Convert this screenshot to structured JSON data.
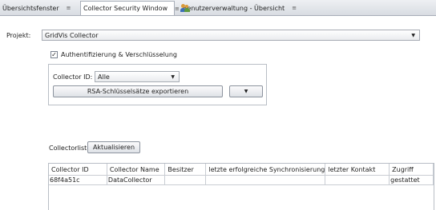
{
  "tabs": [
    {
      "label": "Übersichtsfenster",
      "close": "≡"
    },
    {
      "label": "Collector Security Window",
      "close": "≡"
    },
    {
      "label": "Benutzerverwaltung - Übersicht",
      "close": "≡"
    }
  ],
  "project": {
    "label": "Projekt:",
    "value": "GridVis Collector"
  },
  "auth": {
    "checkbox_label": "Authentifizierung & Verschlüsselung",
    "checked": true
  },
  "collector": {
    "label": "Collector ID:",
    "value": "Alle"
  },
  "rsa": {
    "export_label": "RSA-Schlüsselsätze exportieren"
  },
  "collectorlist": {
    "label": "Collectorliste",
    "refresh_label": "Aktualisieren"
  },
  "table": {
    "columns": [
      "Collector ID",
      "Collector Name",
      "Besitzer",
      "letzte erfolgreiche Synchronisierung",
      "letzter Kontakt",
      "Zugriff"
    ],
    "rows": [
      [
        "68f4a51c",
        "DataCollector",
        "",
        "",
        "",
        "gestattet"
      ]
    ]
  },
  "icons": {
    "tab3": "users-icon",
    "dropdown": "chevron-down-icon",
    "check": "check-icon"
  }
}
